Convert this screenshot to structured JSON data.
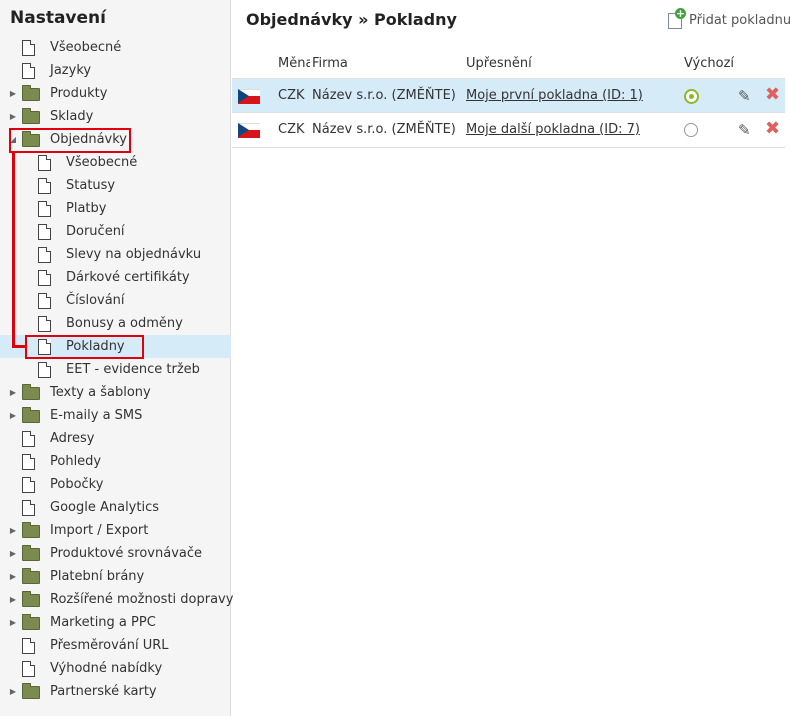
{
  "sidebar": {
    "title": "Nastavení",
    "items": [
      {
        "label": "Všeobecné",
        "icon": "doc"
      },
      {
        "label": "Jazyky",
        "icon": "doc"
      },
      {
        "label": "Produkty",
        "icon": "folder",
        "arrow": "▶"
      },
      {
        "label": "Sklady",
        "icon": "folder",
        "arrow": "▶"
      },
      {
        "label": "Objednávky",
        "icon": "folder",
        "arrow": "◢"
      },
      {
        "label": "Všeobecné",
        "icon": "doc"
      },
      {
        "label": "Statusy",
        "icon": "doc"
      },
      {
        "label": "Platby",
        "icon": "doc"
      },
      {
        "label": "Doručení",
        "icon": "doc"
      },
      {
        "label": "Slevy na objednávku",
        "icon": "doc"
      },
      {
        "label": "Dárkové certifikáty",
        "icon": "doc"
      },
      {
        "label": "Číslování",
        "icon": "doc"
      },
      {
        "label": "Bonusy a odměny",
        "icon": "doc"
      },
      {
        "label": "Pokladny",
        "icon": "doc",
        "selected": true
      },
      {
        "label": "EET - evidence tržeb",
        "icon": "doc"
      },
      {
        "label": "Texty a šablony",
        "icon": "folder",
        "arrow": "▶"
      },
      {
        "label": "E-maily a SMS",
        "icon": "folder",
        "arrow": "▶"
      },
      {
        "label": "Adresy",
        "icon": "doc"
      },
      {
        "label": "Pohledy",
        "icon": "doc"
      },
      {
        "label": "Pobočky",
        "icon": "doc"
      },
      {
        "label": "Google Analytics",
        "icon": "doc"
      },
      {
        "label": "Import / Export",
        "icon": "folder",
        "arrow": "▶"
      },
      {
        "label": "Produktové srovnávače",
        "icon": "folder",
        "arrow": "▶"
      },
      {
        "label": "Platební brány",
        "icon": "folder",
        "arrow": "▶"
      },
      {
        "label": "Rozšířené možnosti dopravy",
        "icon": "folder",
        "arrow": "▶"
      },
      {
        "label": "Marketing a PPC",
        "icon": "folder",
        "arrow": "▶"
      },
      {
        "label": "Přesměrování URL",
        "icon": "doc"
      },
      {
        "label": "Výhodné nabídky",
        "icon": "doc"
      },
      {
        "label": "Partnerské karty",
        "icon": "folder",
        "arrow": "▶"
      }
    ]
  },
  "main": {
    "title": "Objednávky » Pokladny",
    "add_label": "Přidat pokladnu",
    "columns": {
      "currency": "Měna",
      "company": "Firma",
      "detail": "Upřesnění",
      "default": "Výchozí"
    },
    "rows": [
      {
        "flag": "czech-flag-icon",
        "currency": "CZK",
        "company": "Název s.r.o. (ZMĚŇTE)",
        "detail": "Moje první pokladna (ID: 1)",
        "is_default": true
      },
      {
        "flag": "czech-flag-icon",
        "currency": "CZK",
        "company": "Název s.r.o. (ZMĚŇTE)",
        "detail": "Moje další pokladna (ID: 7)",
        "is_default": false
      }
    ]
  },
  "colors": {
    "highlight": "#e0000b",
    "selection": "#d6ebf8",
    "radio_on": "#8bb927",
    "delete": "#e0605e"
  }
}
